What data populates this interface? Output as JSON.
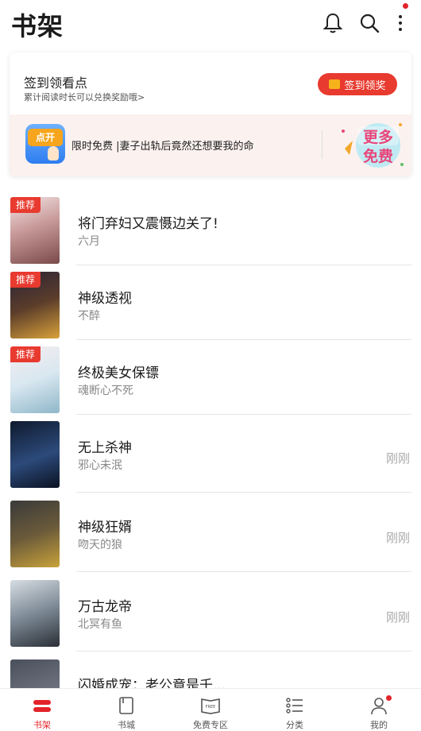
{
  "header": {
    "title": "书架"
  },
  "signin": {
    "title": "签到领看点",
    "subtitle": "累计阅读时长可以兑换奖励哦>",
    "button_label": "签到领奖",
    "promo_icon_label": "点开",
    "promo_text": "限时免费 |妻子出轨后竟然还想要我的命",
    "more_free_label": "更多免费"
  },
  "books": [
    {
      "title": "将门弃妇又震慑边关了!",
      "author": "六月",
      "badge": "推荐",
      "time": ""
    },
    {
      "title": "神级透视",
      "author": "不醉",
      "badge": "推荐",
      "time": ""
    },
    {
      "title": "终极美女保镖",
      "author": "魂断心不死",
      "badge": "推荐",
      "time": ""
    },
    {
      "title": "无上杀神",
      "author": "邪心未泯",
      "badge": "",
      "time": "刚刚"
    },
    {
      "title": "神级狂婿",
      "author": "吻天的狼",
      "badge": "",
      "time": "刚刚"
    },
    {
      "title": "万古龙帝",
      "author": "北冥有鱼",
      "badge": "",
      "time": "刚刚"
    },
    {
      "title": "闪婚成宠：老公竟是千...",
      "author": "",
      "badge": "",
      "time": ""
    }
  ],
  "nav": [
    {
      "label": "书架",
      "icon": "bookshelf-icon",
      "active": true
    },
    {
      "label": "书城",
      "icon": "bookstore-icon",
      "active": false
    },
    {
      "label": "免费专区",
      "icon": "free-zone-icon",
      "active": false
    },
    {
      "label": "分类",
      "icon": "category-icon",
      "active": false
    },
    {
      "label": "我的",
      "icon": "profile-icon",
      "active": false
    }
  ],
  "colors": {
    "accent": "#e3232a",
    "button": "#e83a2f",
    "muted": "#888888"
  }
}
